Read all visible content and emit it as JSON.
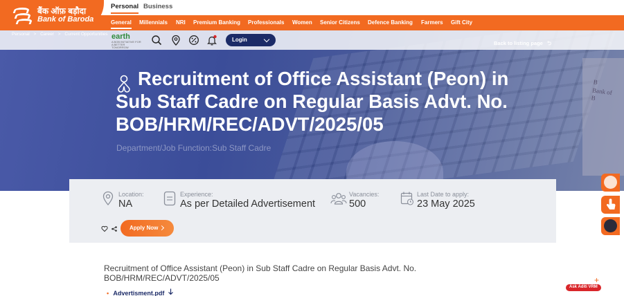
{
  "brand": {
    "name_hi": "बैंक ऑफ़ बड़ौदा",
    "name_en": "Bank of Baroda"
  },
  "segments": [
    {
      "label": "Personal",
      "active": true
    },
    {
      "label": "Business",
      "active": false
    }
  ],
  "nav": [
    {
      "label": "General",
      "active": true
    },
    {
      "label": "Millennials"
    },
    {
      "label": "NRI"
    },
    {
      "label": "Premium Banking"
    },
    {
      "label": "Professionals"
    },
    {
      "label": "Women"
    },
    {
      "label": "Senior Citizens"
    },
    {
      "label": "Defence Banking"
    },
    {
      "label": "Farmers"
    },
    {
      "label": "Gift City"
    }
  ],
  "breadcrumb": [
    "Personal",
    ">",
    "Career",
    ">",
    "Current Opportunities"
  ],
  "toolbar": {
    "earth_label": "earth",
    "earth_tagline": "A BOB INITIATIVE FOR A BETTER TOMORROW",
    "login_label": "Login",
    "back_label": "Back to listing page"
  },
  "job": {
    "title": "Recruitment of Office Assistant (Peon) in Sub Staff Cadre on Regular Basis Advt. No. BOB/HRM/REC/ADVT/2025/05",
    "department": "Department/Job Function:Sub Staff Cadre",
    "location_label": "Location:",
    "location": "NA",
    "experience_label": "Experience:",
    "experience": "As per Detailed Advertisement",
    "vacancies_label": "Vacancies:",
    "vacancies": "500",
    "last_date_label": "Last Date to apply:",
    "last_date": "23 May 2025",
    "apply_label": "Apply Now",
    "document_link": "Advertisment.pdf"
  },
  "float": {
    "plus": "+",
    "vrm_label": "Ask Aditi VRM"
  },
  "colors": {
    "brand_orange": "#f26a21",
    "navy": "#1c2b67",
    "hero_blue": "#3b4d99"
  }
}
